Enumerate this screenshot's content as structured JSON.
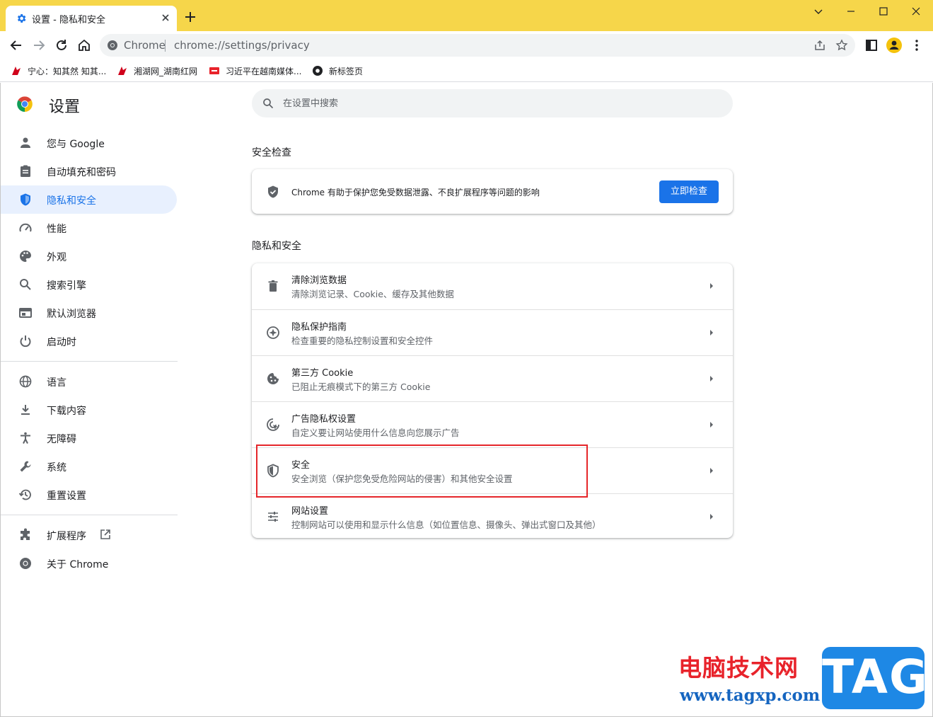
{
  "tab": {
    "title": "设置 - 隐私和安全",
    "icon": "gear-icon"
  },
  "omnibox": {
    "site_label": "Chrome",
    "url": "chrome://settings/privacy"
  },
  "bookmarks": [
    {
      "label": "宁心：知其然 知其..."
    },
    {
      "label": "湘湖网_湖南红网"
    },
    {
      "label": "习近平在越南媒体..."
    },
    {
      "label": "新标签页"
    }
  ],
  "settings": {
    "title": "设置",
    "search_placeholder": "在设置中搜索",
    "nav": [
      {
        "label": "您与 Google",
        "icon": "person-icon"
      },
      {
        "label": "自动填充和密码",
        "icon": "clipboard-icon"
      },
      {
        "label": "隐私和安全",
        "icon": "shield-icon"
      },
      {
        "label": "性能",
        "icon": "speedometer-icon"
      },
      {
        "label": "外观",
        "icon": "palette-icon"
      },
      {
        "label": "搜索引擎",
        "icon": "search-icon"
      },
      {
        "label": "默认浏览器",
        "icon": "browser-icon"
      },
      {
        "label": "启动时",
        "icon": "power-icon"
      },
      {
        "label": "语言",
        "icon": "globe-icon"
      },
      {
        "label": "下载内容",
        "icon": "download-icon"
      },
      {
        "label": "无障碍",
        "icon": "accessibility-icon"
      },
      {
        "label": "系统",
        "icon": "wrench-icon"
      },
      {
        "label": "重置设置",
        "icon": "history-icon"
      },
      {
        "label": "扩展程序",
        "icon": "puzzle-icon"
      },
      {
        "label": "关于 Chrome",
        "icon": "chrome-icon"
      }
    ],
    "safety_check": {
      "heading": "安全检查",
      "text": "Chrome 有助于保护您免受数据泄露、不良扩展程序等问题的影响",
      "button": "立即检查"
    },
    "privacy": {
      "heading": "隐私和安全",
      "rows": [
        {
          "title": "清除浏览数据",
          "subtitle": "清除浏览记录、Cookie、缓存及其他数据",
          "icon": "trash-icon"
        },
        {
          "title": "隐私保护指南",
          "subtitle": "检查重要的隐私控制设置和安全控件",
          "icon": "compass-icon"
        },
        {
          "title": "第三方 Cookie",
          "subtitle": "已阻止无痕模式下的第三方 Cookie",
          "icon": "cookie-icon"
        },
        {
          "title": "广告隐私权设置",
          "subtitle": "自定义要让网站使用什么信息向您展示广告",
          "icon": "ads-icon"
        },
        {
          "title": "安全",
          "subtitle": "安全浏览（保护您免受危险网站的侵害）和其他安全设置",
          "icon": "security-shield-icon"
        },
        {
          "title": "网站设置",
          "subtitle": "控制网站可以使用和显示什么信息（如位置信息、摄像头、弹出式窗口及其他）",
          "icon": "tune-icon"
        }
      ]
    }
  },
  "watermark": {
    "text": "电脑技术网",
    "url": "www.tagxp.com",
    "badge": "TAG"
  },
  "colors": {
    "frame": "#f6d64a",
    "accent": "#1a73e8",
    "active_nav_bg": "#e8f0fe",
    "highlight": "#e5262a"
  }
}
